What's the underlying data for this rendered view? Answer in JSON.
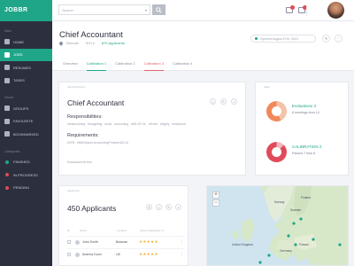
{
  "app": {
    "logo": "JOBBR"
  },
  "sidebar": {
    "section_main": "Main",
    "items": [
      {
        "label": "HOME",
        "icon": "home-icon"
      },
      {
        "label": "JOBS",
        "icon": "briefcase-icon",
        "active": true
      },
      {
        "label": "RESUMES",
        "icon": "document-icon"
      },
      {
        "label": "TASKS",
        "icon": "tasks-icon"
      }
    ],
    "section_saved": "Saved",
    "saved_items": [
      {
        "label": "GROUPS",
        "icon": "groups-icon"
      },
      {
        "label": "FAVOURITE",
        "icon": "heart-icon"
      },
      {
        "label": "BOOKMARKED",
        "icon": "bookmark-icon"
      }
    ],
    "section_categories": "Categories",
    "categories": [
      {
        "label": "FINISHED",
        "color": "#1fa688"
      },
      {
        "label": "IN PROGRESS",
        "color": "#e04b5a"
      },
      {
        "label": "PENDING",
        "color": "#e04b5a"
      }
    ]
  },
  "topbar": {
    "search_placeholder": "Search"
  },
  "header": {
    "title": "Chief Accountant",
    "location": "Remote",
    "salary": "$70 k",
    "applicants_link": "870 Applicants",
    "opened": "Opened August 27th, 2019",
    "tabs": [
      "Overview",
      "Calibration 1",
      "Calibration 2",
      "Calibration 3",
      "Calibration 4"
    ]
  },
  "job_card": {
    "label": "Job Description",
    "title": "Chief Accountant",
    "responsibilities_heading": "Responsibilities:",
    "responsibilities_tags": "#restructuring  #budgeting  #cost accounting  #AR-AP-GL  #Excel  #highly meticulous",
    "requirements_heading": "Requirements:",
    "requirements_tags": "#CPA  #MinDegree:Accounting/Finance/ACCA",
    "download_link": "Download full text"
  },
  "side_card": {
    "label": "Stats",
    "evaluation": {
      "title": "Evaluations 3",
      "subtitle": "8 meetings from 14",
      "color": "#f0895a"
    },
    "calibration": {
      "title": "CALIBRATION 2",
      "subtitle": "Passed 7 from 8",
      "color": "#e04b5a"
    }
  },
  "applicants": {
    "label": "Applicants",
    "title": "450 Applicants",
    "columns": [
      "ID",
      "Name",
      "Location",
      "Score (Calibration 1)"
    ],
    "rows": [
      {
        "name": "John Smith",
        "location": "Bulacan",
        "stars": "★★★★★"
      },
      {
        "name": "Andrew Dunn",
        "location": "UK",
        "stars": "★★★★★"
      }
    ]
  },
  "map": {
    "labels": [
      "Norway",
      "Finland",
      "Sweden",
      "United Kingdom",
      "Poland",
      "Germany"
    ],
    "zoom_in": "+",
    "zoom_out": "−"
  }
}
